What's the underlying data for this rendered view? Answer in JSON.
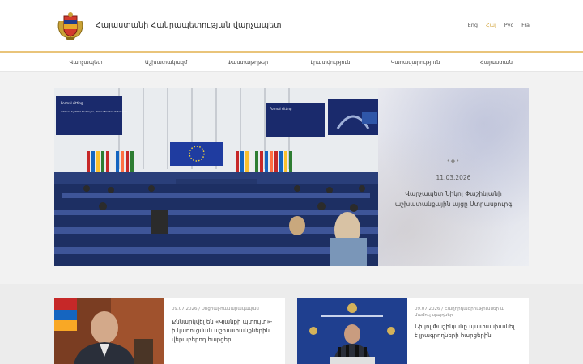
{
  "header": {
    "title": "Հայաստանի Հանրապետության վարչապետ",
    "languages": [
      {
        "label": "Eng",
        "active": false
      },
      {
        "label": "Հայ",
        "active": true
      },
      {
        "label": "Рус",
        "active": false
      },
      {
        "label": "Fra",
        "active": false
      }
    ]
  },
  "nav": {
    "items": [
      "Վարչապետ",
      "Աշխատակազմ",
      "Փաստաթղթեր",
      "Լրատվություն",
      "Կառավարություն",
      "Հայաստան"
    ]
  },
  "hero": {
    "deco": "•◆•",
    "date": "11.03.2026",
    "caption": "Վարչապետ Նիկոլ Փաշինյանի աշխատանքային այցը Ստրասբուրգ",
    "photo_screen_texts": [
      "Formal sitting",
      "Address by Nikol Pashinyan, Prime Minister of Armenia"
    ],
    "slides": 4,
    "active_slide": 0
  },
  "news": [
    {
      "date": "09.07.2026",
      "category": "Սոցիալ-հասարակական",
      "title": "Քննարկվել են «Կյանքի պտույտ»-ի կառուցման աշխատանքներին վերաբերող հարցեր"
    },
    {
      "date": "09.07.2026",
      "category": "Հաղորդագրություններ և մամուլ սլայդներ",
      "title": "Նիկոլ Փաշինյանը պատասխանել է լրագրողների հարցերին"
    }
  ],
  "colors": {
    "accent_gold": "#e9c47a",
    "active_lang": "#d4a843",
    "parliament_blue": "#1b2b55"
  }
}
